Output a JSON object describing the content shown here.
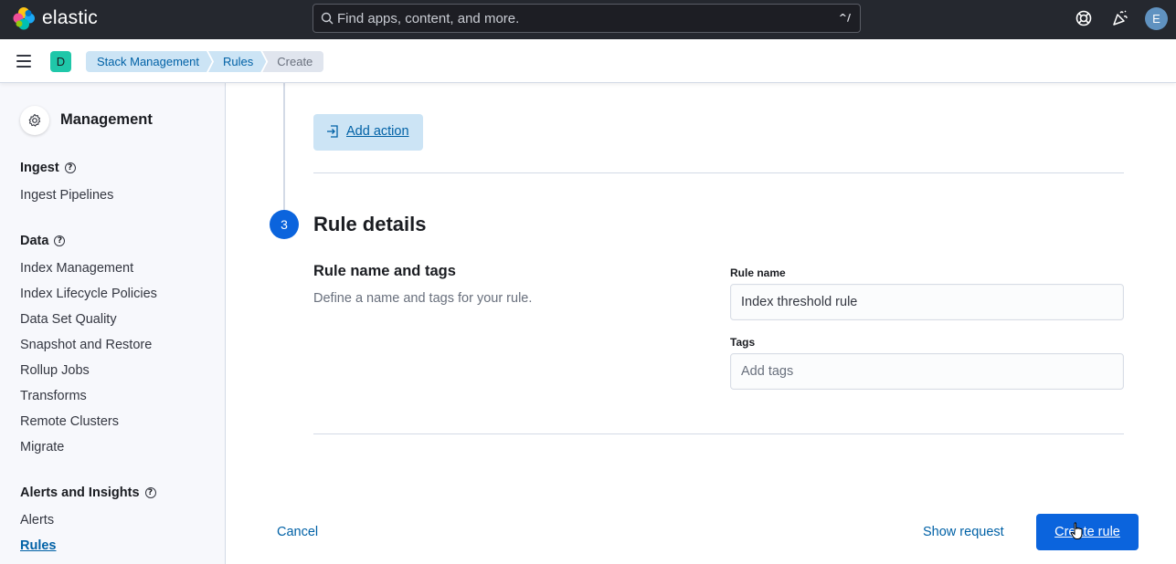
{
  "header": {
    "brand": "elastic",
    "search_placeholder": "Find apps, content, and more.",
    "search_shortcut": "^/",
    "icons": [
      "help-ring-icon",
      "newsfeed-icon"
    ],
    "user_initial": "E"
  },
  "breadcrumbs": {
    "space_initial": "D",
    "items": [
      "Stack Management",
      "Rules",
      "Create"
    ]
  },
  "sidebar": {
    "title": "Management",
    "groups": [
      {
        "title": "Ingest",
        "items": [
          "Ingest Pipelines"
        ]
      },
      {
        "title": "Data",
        "items": [
          "Index Management",
          "Index Lifecycle Policies",
          "Data Set Quality",
          "Snapshot and Restore",
          "Rollup Jobs",
          "Transforms",
          "Remote Clusters",
          "Migrate"
        ]
      },
      {
        "title": "Alerts and Insights",
        "items": [
          "Alerts",
          "Rules"
        ]
      }
    ],
    "active_item": "Rules"
  },
  "main": {
    "add_action_label": "Add action",
    "step_number": "3",
    "step_title": "Rule details",
    "section_title": "Rule name and tags",
    "section_description": "Define a name and tags for your rule.",
    "rule_name_label": "Rule name",
    "rule_name_value": "Index threshold rule",
    "tags_label": "Tags",
    "tags_placeholder": "Add tags",
    "cancel_label": "Cancel",
    "show_request_label": "Show request",
    "create_label": "Create rule"
  },
  "colors": {
    "header_bg": "#25282f",
    "accent": "#0b64dd",
    "link": "#0061a6",
    "space_badge": "#1fc7a9"
  }
}
